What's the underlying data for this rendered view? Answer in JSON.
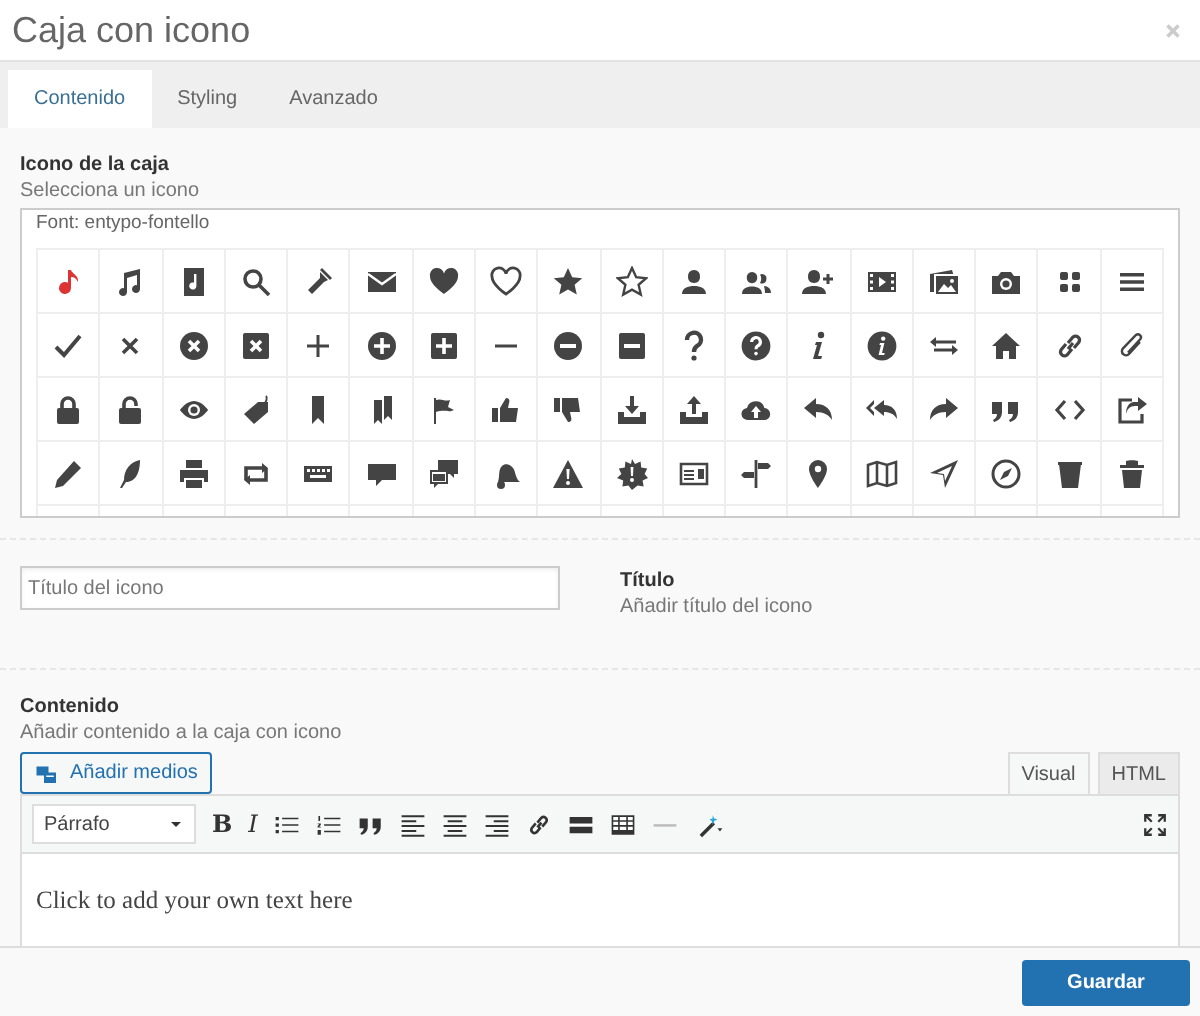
{
  "window": {
    "title": "Caja con icono"
  },
  "tabs": [
    {
      "label": "Contenido",
      "selected": true
    },
    {
      "label": "Styling",
      "selected": false
    },
    {
      "label": "Avanzado",
      "selected": false
    }
  ],
  "icon_field": {
    "label": "Icono de la caja",
    "description": "Selecciona un icono",
    "font_label": "Font: entypo-fontello",
    "icons": [
      {
        "selected": true
      },
      {
        "selected": false
      },
      {
        "selected": false
      },
      {
        "selected": false
      },
      {
        "selected": false
      },
      {
        "selected": false
      },
      {
        "selected": false
      },
      {
        "selected": false
      },
      {
        "selected": false
      },
      {
        "selected": false
      },
      {
        "selected": false
      },
      {
        "selected": false
      },
      {
        "selected": false
      },
      {
        "selected": false
      },
      {
        "selected": false
      },
      {
        "selected": false
      },
      {
        "selected": false
      },
      {
        "selected": false
      },
      {
        "selected": false
      },
      {
        "selected": false
      },
      {
        "selected": false
      },
      {
        "selected": false
      },
      {
        "selected": false
      },
      {
        "selected": false
      },
      {
        "selected": false
      },
      {
        "selected": false
      },
      {
        "selected": false
      },
      {
        "selected": false
      },
      {
        "selected": false
      },
      {
        "selected": false
      },
      {
        "selected": false
      },
      {
        "selected": false
      },
      {
        "selected": false
      },
      {
        "selected": false
      },
      {
        "selected": false
      },
      {
        "selected": false
      },
      {
        "selected": false
      },
      {
        "selected": false
      },
      {
        "selected": false
      },
      {
        "selected": false
      },
      {
        "selected": false
      },
      {
        "selected": false
      },
      {
        "selected": false
      },
      {
        "selected": false
      },
      {
        "selected": false
      },
      {
        "selected": false
      },
      {
        "selected": false
      },
      {
        "selected": false
      },
      {
        "selected": false
      },
      {
        "selected": false
      },
      {
        "selected": false
      },
      {
        "selected": false
      },
      {
        "selected": false
      },
      {
        "selected": false
      },
      {
        "selected": false
      },
      {
        "selected": false
      },
      {
        "selected": false
      },
      {
        "selected": false
      },
      {
        "selected": false
      },
      {
        "selected": false
      },
      {
        "selected": false
      },
      {
        "selected": false
      },
      {
        "selected": false
      },
      {
        "selected": false
      },
      {
        "selected": false
      },
      {
        "selected": false
      },
      {
        "selected": false
      },
      {
        "selected": false
      },
      {
        "selected": false
      },
      {
        "selected": false
      },
      {
        "selected": false
      },
      {
        "selected": false
      }
    ]
  },
  "title_field": {
    "placeholder": "Título del icono",
    "label": "Título",
    "description": "Añadir título del icono"
  },
  "content_field": {
    "label": "Contenido",
    "description": "Añadir contenido a la caja con icono",
    "media_button": "Añadir medios",
    "editor_tabs": [
      {
        "label": "Visual",
        "selected": true
      },
      {
        "label": "HTML",
        "selected": false
      }
    ],
    "format": "Párrafo",
    "toolbar": [
      {
        "kind": "bold",
        "label": "B"
      },
      {
        "kind": "italic",
        "label": "I"
      },
      {
        "kind": "bullets"
      },
      {
        "kind": "numbers"
      },
      {
        "kind": "quote"
      },
      {
        "kind": "align-left"
      },
      {
        "kind": "align-center"
      },
      {
        "kind": "align-right"
      },
      {
        "kind": "link"
      },
      {
        "kind": "more"
      },
      {
        "kind": "table"
      },
      {
        "kind": "rule"
      },
      {
        "kind": "wand"
      }
    ],
    "text": "Click to add your own text here"
  },
  "footer": {
    "save_button": "Guardar"
  }
}
